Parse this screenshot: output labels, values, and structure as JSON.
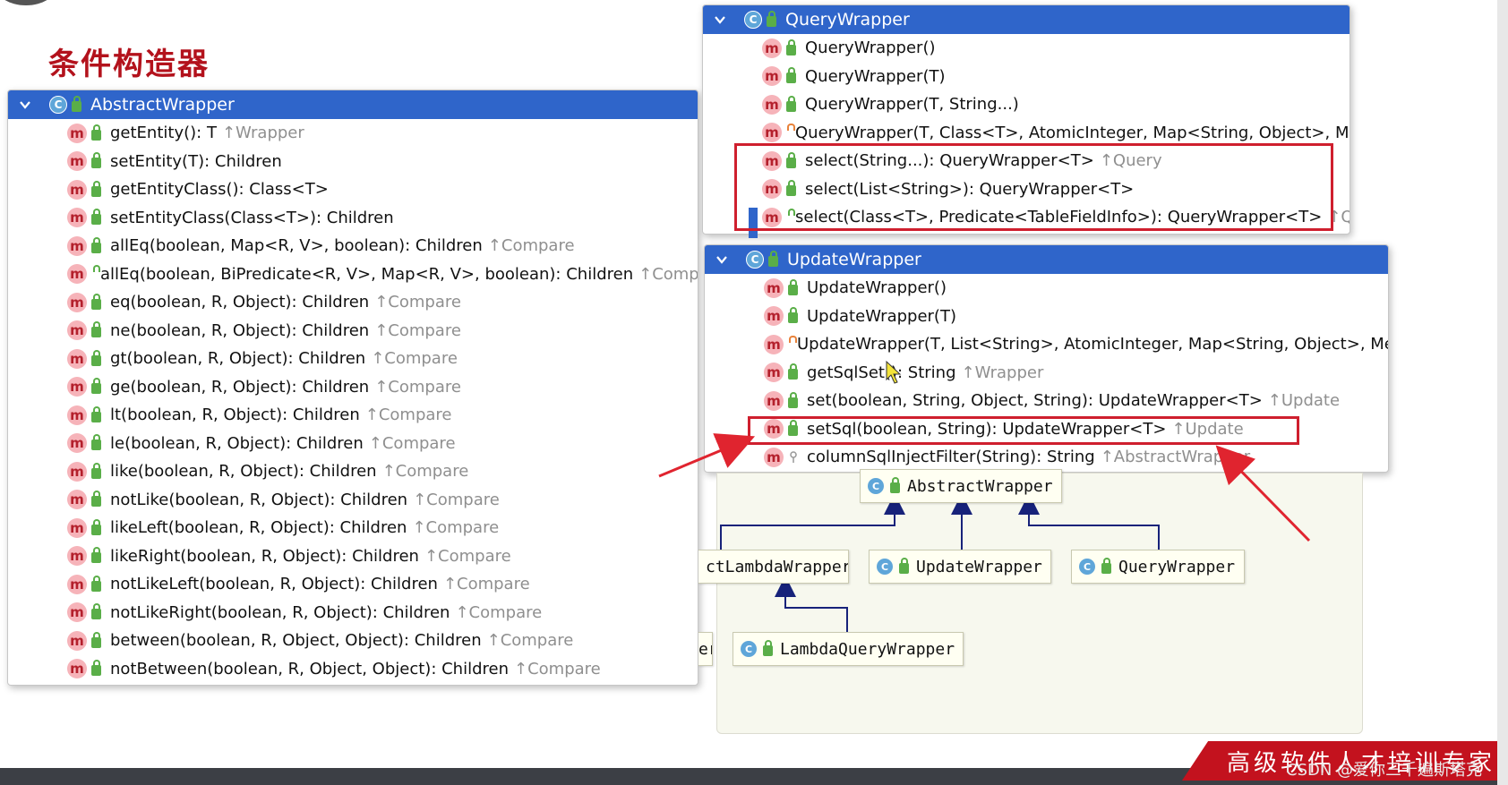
{
  "slide_title": "条件构造器",
  "abstract_wrapper_panel": {
    "title": "AbstractWrapper",
    "class_icon": "C",
    "method_icon": "m",
    "items": [
      {
        "sig": "getEntity(): T",
        "inh": "↑Wrapper"
      },
      {
        "sig": "setEntity(T): Children",
        "inh": ""
      },
      {
        "sig": "getEntityClass(): Class<T>",
        "inh": ""
      },
      {
        "sig": "setEntityClass(Class<T>): Children",
        "inh": ""
      },
      {
        "sig": "allEq(boolean, Map<R, V>, boolean): Children",
        "inh": "↑Compare"
      },
      {
        "sig": "allEq(boolean, BiPredicate<R, V>, Map<R, V>, boolean): Children",
        "inh": "↑Compare"
      },
      {
        "sig": "eq(boolean, R, Object): Children",
        "inh": "↑Compare"
      },
      {
        "sig": "ne(boolean, R, Object): Children",
        "inh": "↑Compare"
      },
      {
        "sig": "gt(boolean, R, Object): Children",
        "inh": "↑Compare"
      },
      {
        "sig": "ge(boolean, R, Object): Children",
        "inh": "↑Compare"
      },
      {
        "sig": "lt(boolean, R, Object): Children",
        "inh": "↑Compare"
      },
      {
        "sig": "le(boolean, R, Object): Children",
        "inh": "↑Compare"
      },
      {
        "sig": "like(boolean, R, Object): Children",
        "inh": "↑Compare"
      },
      {
        "sig": "notLike(boolean, R, Object): Children",
        "inh": "↑Compare"
      },
      {
        "sig": "likeLeft(boolean, R, Object): Children",
        "inh": "↑Compare"
      },
      {
        "sig": "likeRight(boolean, R, Object): Children",
        "inh": "↑Compare"
      },
      {
        "sig": "notLikeLeft(boolean, R, Object): Children",
        "inh": "↑Compare"
      },
      {
        "sig": "notLikeRight(boolean, R, Object): Children",
        "inh": "↑Compare"
      },
      {
        "sig": "between(boolean, R, Object, Object): Children",
        "inh": "↑Compare"
      },
      {
        "sig": "notBetween(boolean, R, Object, Object): Children",
        "inh": "↑Compare"
      }
    ]
  },
  "query_wrapper_panel": {
    "title": "QueryWrapper",
    "items": [
      {
        "sig": "QueryWrapper()",
        "inh": "",
        "access": "public"
      },
      {
        "sig": "QueryWrapper(T)",
        "inh": "",
        "access": "public"
      },
      {
        "sig": "QueryWrapper(T, String...)",
        "inh": "",
        "access": "public"
      },
      {
        "sig": "QueryWrapper(T, Class<T>, AtomicInteger, Map<String, Object>, MergeSeg",
        "inh": "",
        "access": "private"
      },
      {
        "sig": "select(String...): QueryWrapper<T>",
        "inh": "↑Query",
        "access": "public"
      },
      {
        "sig": "select(List<String>): QueryWrapper<T>",
        "inh": "",
        "access": "public"
      },
      {
        "sig": "select(Class<T>, Predicate<TableFieldInfo>): QueryWrapper<T>",
        "inh": "↑Query",
        "access": "public"
      }
    ]
  },
  "update_wrapper_panel": {
    "title": "UpdateWrapper",
    "items": [
      {
        "sig": "UpdateWrapper()",
        "inh": "",
        "access": "public"
      },
      {
        "sig": "UpdateWrapper(T)",
        "inh": "",
        "access": "public"
      },
      {
        "sig": "UpdateWrapper(T, List<String>, AtomicInteger, Map<String, Object>, MergeSegr",
        "inh": "",
        "access": "private"
      },
      {
        "sig": "getSqlSet(): String",
        "inh": "↑Wrapper",
        "access": "public"
      },
      {
        "sig": "set(boolean, String, Object, String): UpdateWrapper<T>",
        "inh": "↑Update",
        "access": "public"
      },
      {
        "sig": "setSql(boolean, String): UpdateWrapper<T>",
        "inh": "↑Update",
        "access": "public"
      },
      {
        "sig": "columnSqlInjectFilter(String): String",
        "inh": "↑AbstractWrapper",
        "access": "protected"
      }
    ]
  },
  "diagram": {
    "abstract_wrapper": "AbstractWrapper",
    "abstract_lambda_wrapper": "ctLambdaWrapper",
    "update_wrapper": "UpdateWrapper",
    "query_wrapper": "QueryWrapper",
    "lambda_query_wrapper": "LambdaQueryWrapper",
    "partial_left": "er"
  },
  "banner": {
    "text": "高级软件人才培训专家",
    "watermark": "CSDN @爱你三千遍斯塔克"
  },
  "colors": {
    "header_blue": "#2f65ca",
    "title_red": "#b3121c",
    "highlight_red": "#cf1f2e",
    "arrow_red": "#e0242f",
    "inherit_gray": "#8f8f8f"
  }
}
